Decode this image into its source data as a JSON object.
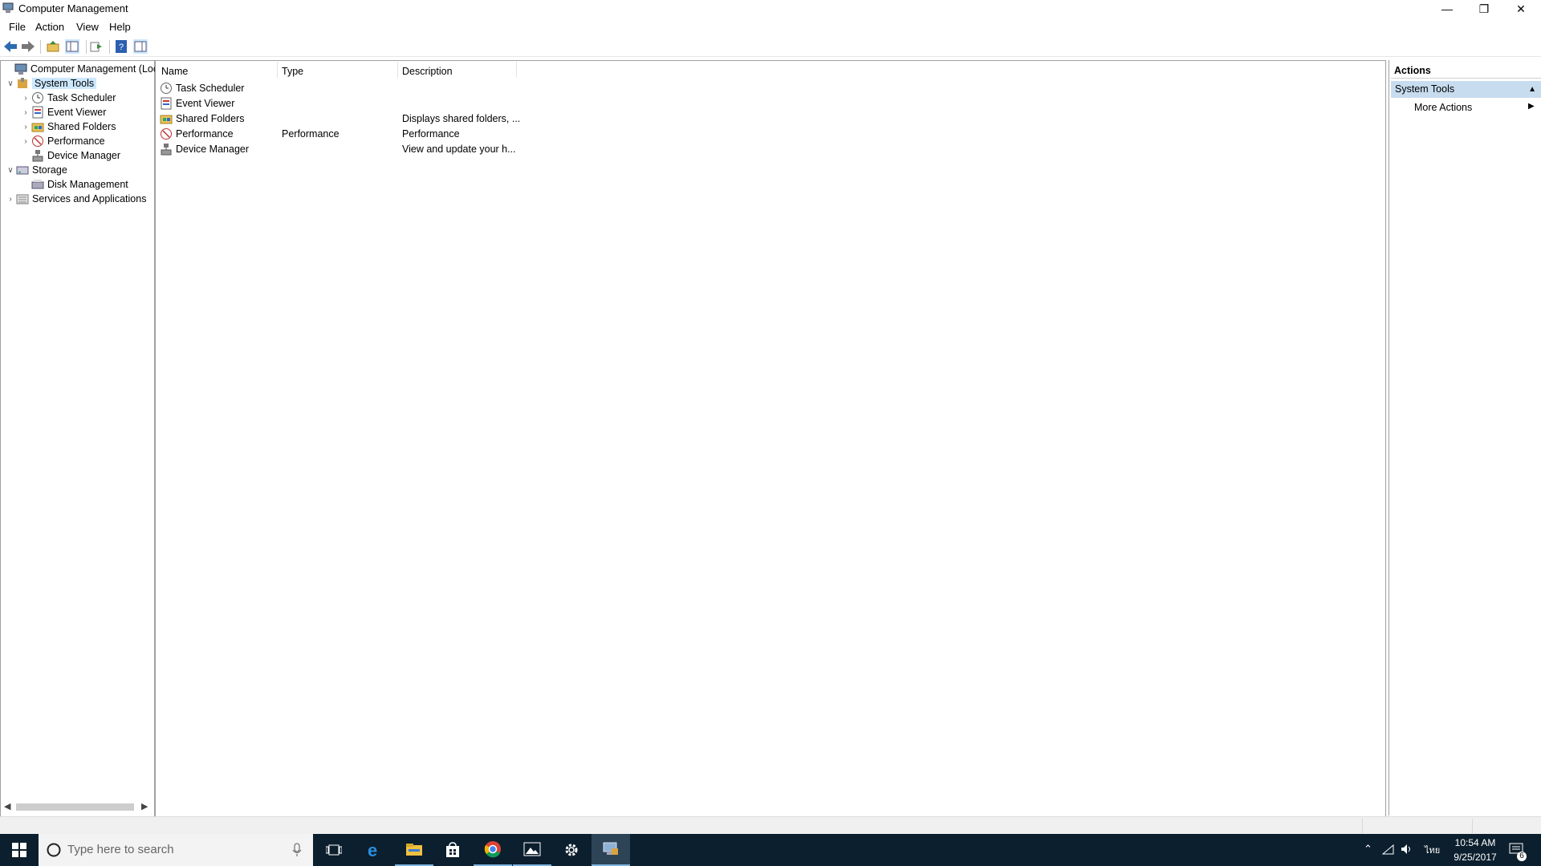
{
  "window": {
    "title": "Computer Management"
  },
  "menu": [
    "File",
    "Action",
    "View",
    "Help"
  ],
  "tree": [
    {
      "label": "Computer Management (Local",
      "level": 0,
      "toggle": ""
    },
    {
      "label": "System Tools",
      "level": 1,
      "toggle": "expanded",
      "selected": true
    },
    {
      "label": "Task Scheduler",
      "level": 2,
      "toggle": "collapsed"
    },
    {
      "label": "Event Viewer",
      "level": 2,
      "toggle": "collapsed"
    },
    {
      "label": "Shared Folders",
      "level": 2,
      "toggle": "collapsed"
    },
    {
      "label": "Performance",
      "level": 2,
      "toggle": "collapsed"
    },
    {
      "label": "Device Manager",
      "level": 2,
      "toggle": ""
    },
    {
      "label": "Storage",
      "level": 1,
      "toggle": "expanded"
    },
    {
      "label": "Disk Management",
      "level": 2,
      "toggle": ""
    },
    {
      "label": "Services and Applications",
      "level": 1,
      "toggle": "collapsed"
    }
  ],
  "list": {
    "columns": [
      "Name",
      "Type",
      "Description"
    ],
    "rows": [
      {
        "name": "Task Scheduler",
        "type": "",
        "description": ""
      },
      {
        "name": "Event Viewer",
        "type": "",
        "description": ""
      },
      {
        "name": "Shared Folders",
        "type": "",
        "description": "Displays shared folders, ..."
      },
      {
        "name": "Performance",
        "type": "Performance",
        "description": "Performance"
      },
      {
        "name": "Device Manager",
        "type": "",
        "description": "View and update your h..."
      }
    ]
  },
  "actions": {
    "header": "Actions",
    "group": "System Tools",
    "more": "More Actions"
  },
  "taskbar": {
    "search_placeholder": "Type here to search",
    "time": "10:54 AM",
    "date": "9/25/2017",
    "notifications": "6"
  },
  "colors": {
    "selection": "#cce8ff",
    "actions_group": "#c7dcef",
    "taskbar": "#0c1f2e"
  }
}
